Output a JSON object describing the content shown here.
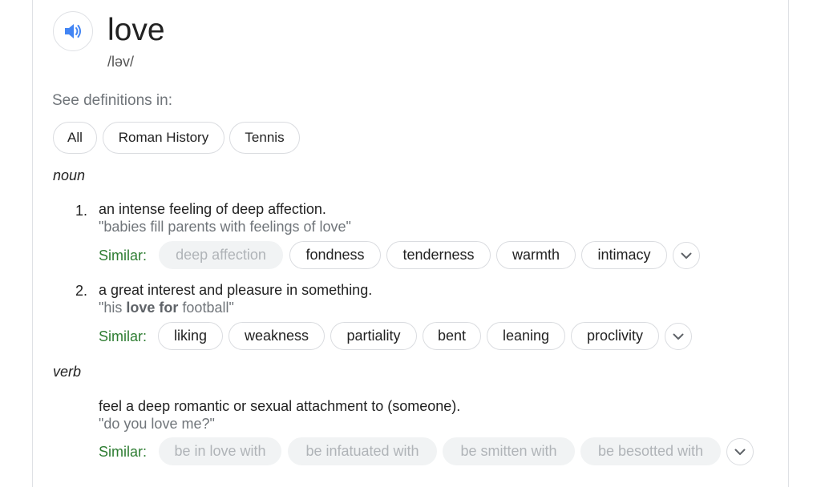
{
  "entry": {
    "word": "love",
    "phonetic": "/ləv/",
    "speaker_icon": "volume-up-icon"
  },
  "see_definitions": {
    "label": "See definitions in:",
    "chips": [
      "All",
      "Roman History",
      "Tennis"
    ]
  },
  "noun": {
    "label": "noun",
    "senses": [
      {
        "number": "1.",
        "definition": "an intense feeling of deep affection.",
        "example": "\"babies fill parents with feelings of love\"",
        "similar_label": "Similar:",
        "similar": [
          {
            "text": "deep affection",
            "muted": true
          },
          {
            "text": "fondness",
            "muted": false
          },
          {
            "text": "tenderness",
            "muted": false
          },
          {
            "text": "warmth",
            "muted": false
          },
          {
            "text": "intimacy",
            "muted": false
          }
        ]
      },
      {
        "number": "2.",
        "definition": "a great interest and pleasure in something.",
        "example_pre": "\"his ",
        "example_bold": "love for",
        "example_post": " football\"",
        "similar_label": "Similar:",
        "similar": [
          {
            "text": "liking",
            "muted": false
          },
          {
            "text": "weakness",
            "muted": false
          },
          {
            "text": "partiality",
            "muted": false
          },
          {
            "text": "bent",
            "muted": false
          },
          {
            "text": "leaning",
            "muted": false
          },
          {
            "text": "proclivity",
            "muted": false
          }
        ]
      }
    ]
  },
  "verb": {
    "label": "verb",
    "senses": [
      {
        "definition": "feel a deep romantic or sexual attachment to (someone).",
        "example": "\"do you love me?\"",
        "similar_label": "Similar:",
        "similar": [
          {
            "text": "be in love with",
            "muted": true
          },
          {
            "text": "be infatuated with",
            "muted": true
          },
          {
            "text": "be smitten with",
            "muted": true
          },
          {
            "text": "be besotted with",
            "muted": true
          }
        ]
      }
    ]
  },
  "icons": {
    "expand": "chevron-down-icon"
  },
  "colors": {
    "speaker_blue": "#4285f4",
    "similar_green": "#2e7d32",
    "muted_chip_bg": "#f1f3f4"
  }
}
